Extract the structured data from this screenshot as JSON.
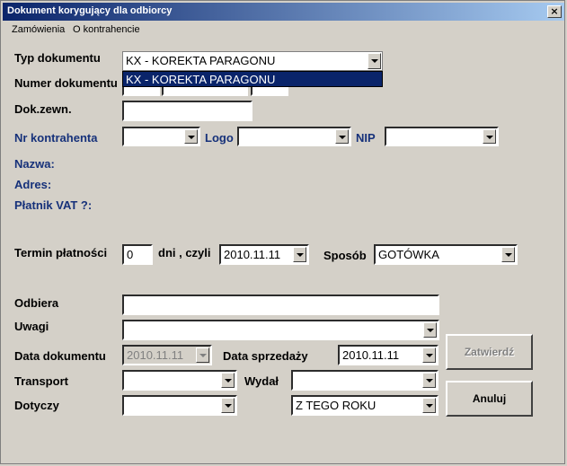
{
  "window": {
    "title": "Dokument korygujący dla odbiorcy",
    "close_glyph": "×"
  },
  "menu": {
    "items": [
      "Zamówienia",
      "O kontrahencie"
    ]
  },
  "form": {
    "doc_type": {
      "label": "Typ dokumentu",
      "value": "KX - KOREKTA PARAGONU",
      "dropdown_option": "KX - KOREKTA PARAGONU"
    },
    "doc_number": {
      "label": "Numer dokumentu"
    },
    "ext_doc": {
      "label": "Dok.zewn.",
      "value": ""
    },
    "contractor_no": {
      "label": "Nr kontrahenta",
      "value": ""
    },
    "logo": {
      "label": "Logo",
      "value": ""
    },
    "nip": {
      "label": "NIP",
      "value": ""
    },
    "name": {
      "label": "Nazwa:"
    },
    "address": {
      "label": "Adres:"
    },
    "vat_payer": {
      "label": "Płatnik VAT ?:"
    },
    "payment_term": {
      "label": "Termin płatności",
      "days_value": "0",
      "days_label": "dni , czyli",
      "date_value": "2010.11.11"
    },
    "payment_method": {
      "label": "Sposób",
      "value": "GOTÓWKA"
    },
    "receiver": {
      "label": "Odbiera",
      "value": ""
    },
    "remarks": {
      "label": "Uwagi",
      "value": ""
    },
    "doc_date": {
      "label": "Data dokumentu",
      "value": "2010.11.11"
    },
    "sale_date": {
      "label": "Data sprzedaży",
      "value": "2010.11.11"
    },
    "transport": {
      "label": "Transport",
      "value": ""
    },
    "issued": {
      "label": "Wydał",
      "value": ""
    },
    "concerns": {
      "label": "Dotyczy",
      "value": "",
      "year_value": "Z TEGO ROKU"
    }
  },
  "buttons": {
    "confirm": "Zatwierdź",
    "cancel": "Anuluj"
  },
  "colors": {
    "title_start": "#0a246a",
    "title_end": "#a6caf0",
    "label_blue": "#16317a",
    "face": "#d4d0c8"
  }
}
